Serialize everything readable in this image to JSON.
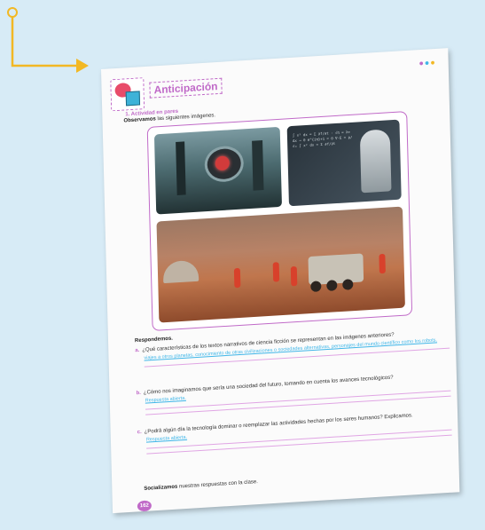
{
  "page": {
    "title": "Anticipación",
    "activity_label": "1. Actividad en pares",
    "observe_bold": "Observamos",
    "observe_rest": " las siguientes imágenes.",
    "respond_label": "Respondemos.",
    "questions": [
      {
        "letter": "a.",
        "text": "¿Qué características de los textos narrativos de ciencia ficción se representan en las imágenes anteriores?",
        "answer": "viajes a otros planetas, conocimiento de otras civilizaciones o sociedades alternativas, personajes del mundo científico como los robots."
      },
      {
        "letter": "b.",
        "text": "¿Cómo nos imaginamos que sería una sociedad del futuro, tomando en cuenta los avances tecnológicos?",
        "answer": "Respuesta abierta."
      },
      {
        "letter": "c.",
        "text": "¿Podrá algún día la tecnología dominar o reemplazar las actividades hechas por los seres humanos? Explicamos.",
        "answer": "Respuesta abierta."
      }
    ],
    "social_bold": "Socializamos",
    "social_rest": " nuestras respuestas con la clase.",
    "page_number": "162"
  },
  "colors": {
    "accent": "#c06ac8",
    "answer": "#3fb6e8",
    "arrow": "#f2b824",
    "background": "#d7ebf6"
  }
}
